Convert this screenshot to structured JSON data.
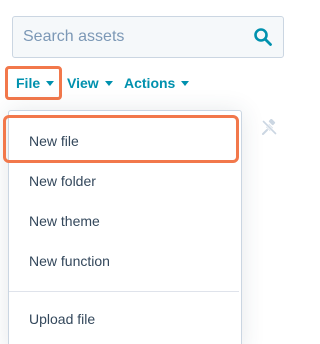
{
  "search": {
    "placeholder": "Search assets",
    "icon": "search-icon"
  },
  "toolbar": {
    "file_label": "File",
    "view_label": "View",
    "actions_label": "Actions"
  },
  "file_menu": {
    "items": [
      {
        "label": "New file",
        "highlighted": true
      },
      {
        "label": "New folder"
      },
      {
        "label": "New theme"
      },
      {
        "label": "New function"
      },
      {
        "label": "Upload file"
      }
    ]
  },
  "colors": {
    "accent": "#0091ae",
    "highlight": "#f2784b",
    "text": "#33475b",
    "input_bg": "#f5f8fa",
    "border": "#cbd6e2"
  },
  "icons": {
    "pin": "unpin-icon"
  }
}
